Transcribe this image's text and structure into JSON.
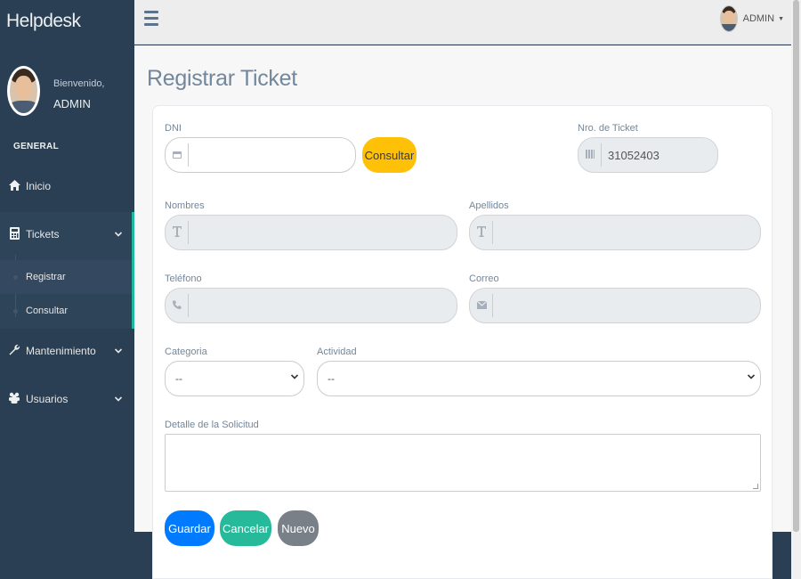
{
  "sidebar": {
    "brand": "Helpdesk",
    "welcome_text": "Bienvenido,",
    "user_name": "ADMIN",
    "section_title": "GENERAL",
    "items": [
      {
        "label": "Inicio",
        "icon": "home-icon"
      },
      {
        "label": "Tickets",
        "icon": "calculator-icon"
      },
      {
        "label": "Mantenimiento",
        "icon": "wrench-icon"
      },
      {
        "label": "Usuarios",
        "icon": "users-icon"
      }
    ],
    "tickets_sub": [
      {
        "label": "Registrar",
        "active": true
      },
      {
        "label": "Consultar",
        "active": false
      }
    ]
  },
  "topbar": {
    "user_label": "ADMIN"
  },
  "page": {
    "title": "Registrar Ticket"
  },
  "form": {
    "dni_label": "DNI",
    "dni_value": "",
    "consultar_label": "Consultar",
    "ticket_label": "Nro. de Ticket",
    "ticket_value": "31052403",
    "nombres_label": "Nombres",
    "apellidos_label": "Apellidos",
    "telefono_label": "Teléfono",
    "correo_label": "Correo",
    "categoria_label": "Categoria",
    "categoria_value": "--",
    "actividad_label": "Actividad",
    "actividad_value": "--",
    "detalle_label": "Detalle de la Solicitud"
  },
  "actions": {
    "guardar": "Guardar",
    "cancelar": "Cancelar",
    "nuevo": "Nuevo"
  },
  "colors": {
    "sidebar_bg": "#2a3f54",
    "accent": "#1abb9c",
    "btn_warning": "#ffc107",
    "btn_primary": "#007bff",
    "btn_success": "#26b99a",
    "btn_secondary": "#7a8088"
  }
}
